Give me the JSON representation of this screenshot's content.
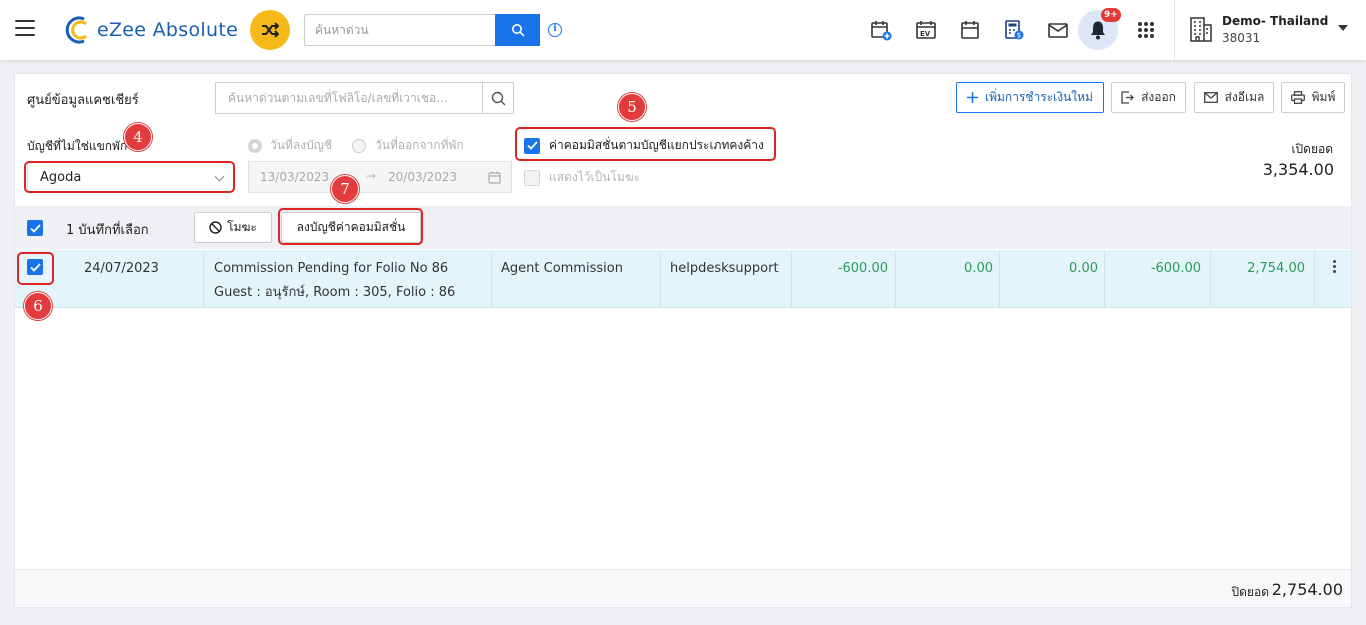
{
  "header": {
    "app_name": "eZee Absolute",
    "search_placeholder": "ค้นหาด่วน",
    "notification_badge": "9+",
    "hotel_name": "Demo- Thailand",
    "hotel_id": "38031",
    "icons": [
      "menu-icon",
      "shuffle-icon",
      "search-icon",
      "info-icon",
      "calendar-add-icon",
      "calendar-ev-icon",
      "calendar-icon",
      "calculator-icon",
      "mail-icon",
      "bell-icon",
      "apps-grid-icon",
      "building-icon"
    ]
  },
  "page": {
    "title": "ศูนย์ข้อมูลแคชเชียร์",
    "search_placeholder": "ค้นหาด่วนตามเลขที่โฟลิโอ/เลขที่เวาเชอ...",
    "buttons": {
      "add_payment": "เพิ่มการชำระเงินใหม่",
      "export": "ส่งออก",
      "email": "ส่งอีเมล",
      "print": "พิมพ์"
    }
  },
  "filters": {
    "account_label": "บัญชีที่ไม่ใช่แขกพัก",
    "account_value": "Agoda",
    "radio_posting_date": "วันที่ลงบัญชี",
    "radio_checkout_date": "วันที่ออกจากที่พัก",
    "date_from": "13/03/2023",
    "date_to": "20/03/2023",
    "commission_checkbox_label": "ค่าคอมมิสชั่นตามบัญชีแยกประเภทคงค้าง",
    "commission_checked": true,
    "show_void_label": "แสดงไว้เป็นโมฆะ",
    "show_void_checked": false,
    "opening_balance_label": "เปิดยอด",
    "opening_balance": "3,354.00"
  },
  "selection": {
    "selected_text": "1 บันทึกที่เลือก",
    "void_button": "โมฆะ",
    "post_commission_button": "ลงบัญชีค่าคอมมิสชั่น"
  },
  "rows": [
    {
      "date": "24/07/2023",
      "description": "Commission Pending for Folio No 86",
      "guest_info": "Guest : อนุรักษ์, Room : 305, Folio : 86",
      "type": "Agent Commission",
      "user": "helpdesksupport",
      "amount1": "-600.00",
      "amount2": "0.00",
      "amount3": "0.00",
      "amount4": "-600.00",
      "balance": "2,754.00",
      "checked": true
    }
  ],
  "footer": {
    "closing_label": "ปิดยอด",
    "closing_balance": "2,754.00"
  },
  "annotations": [
    "4",
    "5",
    "6",
    "7"
  ],
  "colors": {
    "accent": "#1a73e8",
    "shuffle": "#f6b91a",
    "positive_amount": "#2e9a5a",
    "highlight": "#e02424",
    "row_bg": "#e3f4fb"
  }
}
